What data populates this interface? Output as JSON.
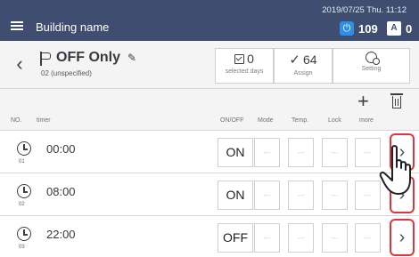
{
  "header": {
    "building_name": "Building name",
    "datetime": "2019/07/25 Thu. 11:12",
    "power_count": "109",
    "alert_count": "0",
    "power_icon_glyph": "⏻",
    "alert_icon_glyph": "A"
  },
  "schedule": {
    "name": "OFF Only",
    "sub_label": "02  (unspecified)"
  },
  "toolbar": {
    "selected_days_value": "0",
    "selected_days_label": "selected days",
    "assign_value": "64",
    "assign_label": "Assign",
    "setting_label": "Setting"
  },
  "columns": {
    "no": "NO.",
    "timer": "timer",
    "onoff": "ON/OFF",
    "mode": "Mode",
    "temp": "Temp.",
    "lock": "Lock",
    "more": "more"
  },
  "rows": [
    {
      "no": "01",
      "time": "00:00",
      "onoff": "ON",
      "mode": "---",
      "temp": "---",
      "lock": "---",
      "more": "---"
    },
    {
      "no": "02",
      "time": "08:00",
      "onoff": "ON",
      "mode": "---",
      "temp": "---",
      "lock": "---",
      "more": "---"
    },
    {
      "no": "03",
      "time": "22:00",
      "onoff": "OFF",
      "mode": "---",
      "temp": "---",
      "lock": "---",
      "more": "---"
    }
  ],
  "icons": {
    "back": "‹",
    "add": "+",
    "pencil": "✎",
    "check": "✓",
    "row_arrow": "›"
  },
  "colors": {
    "header_bg": "#3f4d70",
    "accent_blue": "#2f8fe6",
    "highlight_red": "#d9363e"
  }
}
